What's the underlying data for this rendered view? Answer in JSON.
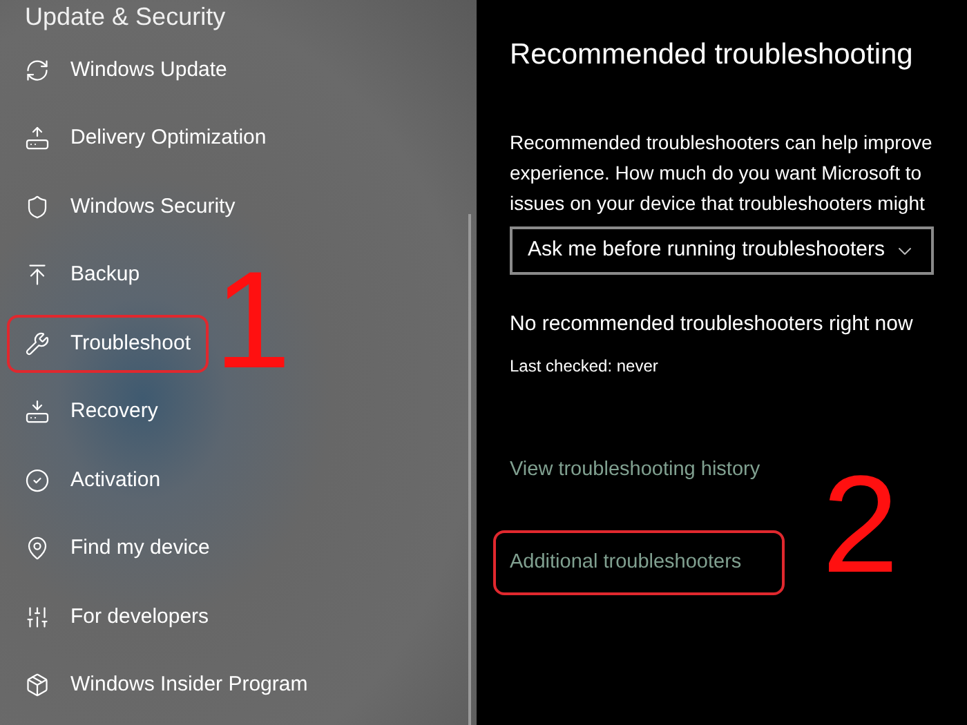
{
  "sidebar": {
    "header": "Update & Security",
    "items": [
      {
        "label": "Windows Update",
        "selected": false
      },
      {
        "label": "Delivery Optimization",
        "selected": false
      },
      {
        "label": "Windows Security",
        "selected": false
      },
      {
        "label": "Backup",
        "selected": false
      },
      {
        "label": "Troubleshoot",
        "selected": true,
        "annotation": "1"
      },
      {
        "label": "Recovery",
        "selected": false
      },
      {
        "label": "Activation",
        "selected": false
      },
      {
        "label": "Find my device",
        "selected": false
      },
      {
        "label": "For developers",
        "selected": false
      },
      {
        "label": "Windows Insider Program",
        "selected": false
      }
    ]
  },
  "content": {
    "title": "Recommended troubleshooting",
    "description": [
      "Recommended troubleshooters can help improve",
      "experience. How much do you want Microsoft to",
      "issues on your device that troubleshooters might"
    ],
    "dropdown": {
      "value": "Ask me before running troubleshooters"
    },
    "status": "No recommended troubleshooters right now",
    "last_checked": "Last checked: never",
    "links": [
      {
        "label": "View troubleshooting history",
        "highlighted": false
      },
      {
        "label": "Additional troubleshooters",
        "highlighted": true,
        "annotation": "2"
      }
    ]
  }
}
